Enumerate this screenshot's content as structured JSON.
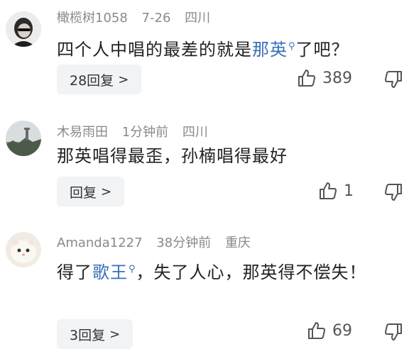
{
  "comments": [
    {
      "username": "橄榄树1058",
      "date": "7-26",
      "location": "四川",
      "text_before": "四个人中唱的最差的就是",
      "link_text": "那英",
      "search_icon": "search-icon",
      "text_after": "了吧？",
      "reply_label": "28回复",
      "likes": "389"
    },
    {
      "username": "木易雨田",
      "date": "1分钟前",
      "location": "四川",
      "text": "那英唱得最歪，孙楠唱得最好",
      "reply_label": "回复",
      "likes": "1"
    },
    {
      "username": "Amanda1227",
      "date": "38分钟前",
      "location": "重庆",
      "text_before": "得了",
      "link_text": "歌王",
      "search_icon": "search-icon",
      "text_after": "，失了人心，那英得不偿失！",
      "reply_label": "3回复",
      "likes": "69"
    }
  ],
  "colors": {
    "link": "#3a6fb8",
    "meta": "#8a8a8a",
    "reply_bg": "#f2f3f5"
  }
}
